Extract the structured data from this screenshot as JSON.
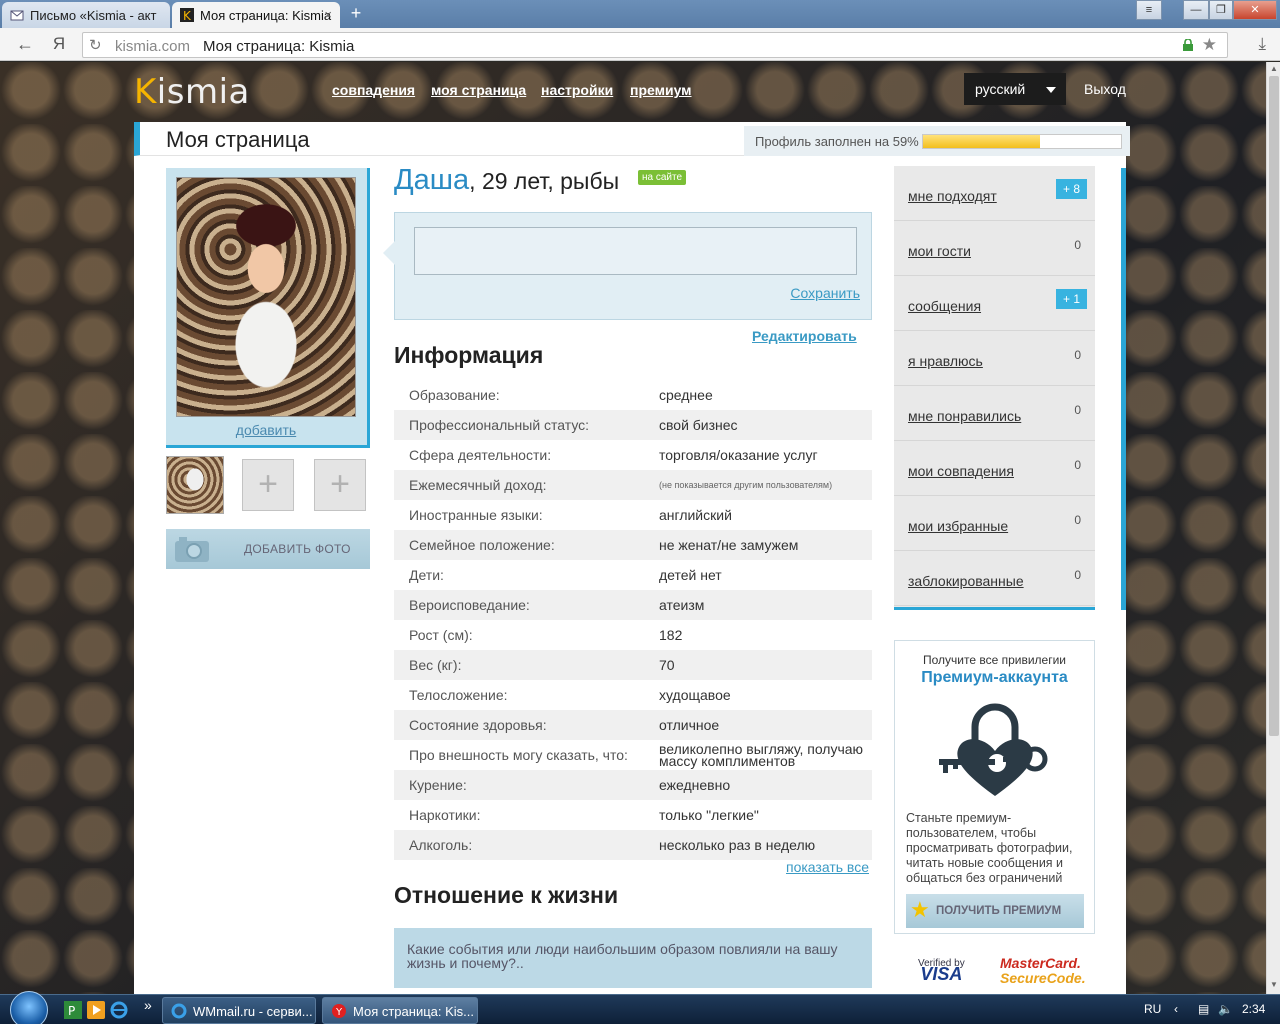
{
  "browser": {
    "tabs": [
      {
        "title": "Письмо «Kismia - акт",
        "active": false
      },
      {
        "title": "Моя страница: Kismia",
        "active": true
      }
    ],
    "new_tab_label": "+",
    "close_glyph": "×",
    "yandex_label": "Я",
    "address": {
      "domain": "kismia.com",
      "page_title": "Моя страница: Kismia"
    },
    "window_buttons": {
      "menu": "≡",
      "minimize": "—",
      "maximize": "❐",
      "close": "✕"
    }
  },
  "site": {
    "logo_k": "K",
    "logo_rest": "ismia",
    "nav": [
      "совпадения",
      "моя страница",
      "настройки",
      "премиум"
    ],
    "language": "русский",
    "logout": "Выход"
  },
  "page": {
    "title": "Моя страница",
    "profile_fill_label": "Профиль заполнен на 59%",
    "profile_fill": 0.59
  },
  "left": {
    "add_link": "добавить",
    "add_photo_button": "ДОБАВИТЬ ФОТО",
    "plus_glyph": "+"
  },
  "profile": {
    "name": "Даша",
    "details": ", 29 лет, рыбы",
    "online_badge": "на сайте",
    "status_placeholder": "",
    "save_link": "Сохранить",
    "edit_link": "Редактировать",
    "info_heading": "Информация",
    "info": [
      {
        "k": "Образование:",
        "v": "среднее"
      },
      {
        "k": "Профессиональный статус:",
        "v": "свой бизнес"
      },
      {
        "k": "Сфера деятельности:",
        "v": "торговля/оказание услуг"
      },
      {
        "k": "Ежемесячный доход:",
        "v": "(не показывается другим пользователям)"
      },
      {
        "k": "Иностранные языки:",
        "v": "английский"
      },
      {
        "k": "Семейное положение:",
        "v": "не женат/не замужем"
      },
      {
        "k": "Дети:",
        "v": "детей нет"
      },
      {
        "k": "Вероисповедание:",
        "v": "атеизм"
      },
      {
        "k": "Рост (см):",
        "v": "182"
      },
      {
        "k": "Вес (кг):",
        "v": "70"
      },
      {
        "k": "Телосложение:",
        "v": "худощавое"
      },
      {
        "k": "Состояние здоровья:",
        "v": "отличное"
      },
      {
        "k": "Про внешность могу сказать, что:",
        "v": "великолепно выгляжу, получаю массу комплиментов"
      },
      {
        "k": "Курение:",
        "v": "ежедневно"
      },
      {
        "k": "Наркотики:",
        "v": "только \"легкие\""
      },
      {
        "k": "Алкоголь:",
        "v": "несколько раз в неделю"
      }
    ],
    "show_all": "показать все",
    "life_heading": "Отношение к жизни",
    "life_question": "Какие события или люди наибольшим образом повлияли на вашу жизнь и почему?.."
  },
  "sidebar": {
    "items": [
      {
        "label": "мне подходят",
        "count": "+ 8",
        "badge": true
      },
      {
        "label": "мои гости",
        "count": "0",
        "badge": false
      },
      {
        "label": "сообщения",
        "count": "+ 1",
        "badge": true
      },
      {
        "label": "я нравлюсь",
        "count": "0",
        "badge": false
      },
      {
        "label": "мне понравились",
        "count": "0",
        "badge": false
      },
      {
        "label": "мои совпадения",
        "count": "0",
        "badge": false
      },
      {
        "label": "мои избранные",
        "count": "0",
        "badge": false
      },
      {
        "label": "заблокированные",
        "count": "0",
        "badge": false
      }
    ]
  },
  "premium": {
    "line1": "Получите все привилегии",
    "line2": "Премиум-аккаунта",
    "description": "Станьте премиум-пользователем, чтобы просматривать фотографии, читать новые сообщения и общаться без ограничений",
    "button": "ПОЛУЧИТЬ ПРЕМИУМ",
    "verified_by": "Verified by",
    "visa": "VISA",
    "mastercard": "MasterCard.",
    "securecode": "SecureCode."
  },
  "taskbar": {
    "more_glyph": "»",
    "buttons": [
      "WMmail.ru - серви...",
      "Моя страница: Kis..."
    ],
    "lang": "RU",
    "time": "2:34"
  },
  "colors": {
    "accent": "#2aa6d6",
    "link": "#3a9ac4",
    "logo_k": "#f5b400",
    "online": "#7bbf36"
  }
}
